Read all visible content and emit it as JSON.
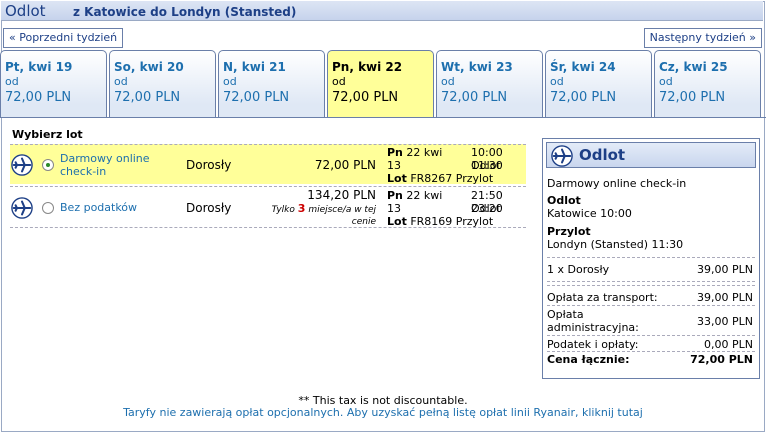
{
  "header": {
    "title": "Odlot",
    "route": "z Katowice do Londyn (Stansted)"
  },
  "nav": {
    "prev": "« Poprzedni tydzień",
    "next": "Następny tydzień »"
  },
  "tabs": [
    {
      "day": "Pt, kwi 19",
      "od": "od",
      "price": "72,00 PLN"
    },
    {
      "day": "So, kwi 20",
      "od": "od",
      "price": "72,00 PLN"
    },
    {
      "day": "N, kwi 21",
      "od": "od",
      "price": "72,00 PLN"
    },
    {
      "day": "Pn, kwi 22",
      "od": "od",
      "price": "72,00 PLN"
    },
    {
      "day": "Wt, kwi 23",
      "od": "od",
      "price": "72,00 PLN"
    },
    {
      "day": "Śr, kwi 24",
      "od": "od",
      "price": "72,00 PLN"
    },
    {
      "day": "Cz, kwi 25",
      "od": "od",
      "price": "72,00 PLN"
    }
  ],
  "select_title": "Wybierz lot",
  "fares": [
    {
      "name_line1": "Darmowy online",
      "name_line2": "check-in",
      "pax": "Dorosły",
      "price": "72,00 PLN",
      "day_label": "Pn",
      "date1": "22 kwi",
      "date2": "13",
      "dep_time": "10:00",
      "dep_label": "Odlot",
      "arr_time": "11:30",
      "lot_label": "Lot",
      "flight": "FR8267",
      "arr_label": "Przylot"
    },
    {
      "name_line1": "Bez podatków",
      "pax": "Dorosły",
      "price": "134,20 PLN",
      "avail_prefix": "Tylko",
      "avail_count": "3",
      "avail_suffix": "miejsce/a w tej",
      "avail_suffix2": "cenie",
      "day_label": "Pn",
      "date1": "22 kwi",
      "date2": "13",
      "dep_time": "21:50",
      "dep_label": "Odlot",
      "arr_time": "23:20",
      "lot_label": "Lot",
      "flight": "FR8169",
      "arr_label": "Przylot"
    }
  ],
  "summary": {
    "title": "Odlot",
    "fare": "Darmowy online check-in",
    "dep_label": "Odlot",
    "dep_value": "Katowice 10:00",
    "arr_label": "Przylot",
    "arr_value": "Londyn (Stansted) 11:30",
    "pax_label": "1 x Dorosły",
    "pax_value": "39,00 PLN",
    "transport_label": "Opłata za transport:",
    "transport_value": "39,00 PLN",
    "admin_label1": "Opłata",
    "admin_label2": "administracyjna:",
    "admin_value": "33,00 PLN",
    "tax_label": "Podatek i opłaty:",
    "tax_value": "0,00 PLN",
    "total_label": "Cena łącznie:",
    "total_value": "72,00 PLN"
  },
  "footer": {
    "note": "** This tax is not discountable.",
    "link": "Taryfy nie zawierają opłat opcjonalnych. Aby uzyskać pełną listę opłat linii Ryanair, kliknij tutaj"
  },
  "colors": {
    "accent": "#1d6fae",
    "highlight": "#ffff99",
    "header": "#1d3f86"
  }
}
